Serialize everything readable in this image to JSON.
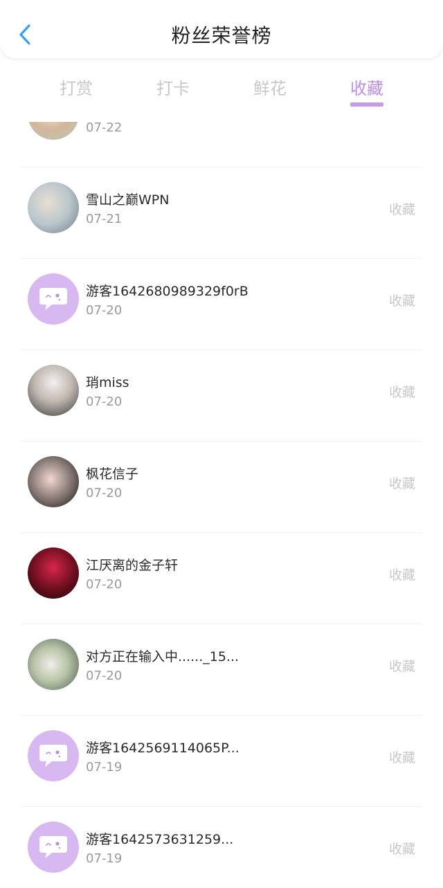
{
  "header": {
    "title": "粉丝荣誉榜",
    "back_icon": "chevron-left-icon",
    "accent_color": "#3a9ff0"
  },
  "tabs": [
    {
      "label": "打赏",
      "active": false
    },
    {
      "label": "打卡",
      "active": false
    },
    {
      "label": "鲜花",
      "active": false
    },
    {
      "label": "收藏",
      "active": true
    }
  ],
  "theme": {
    "active_tab_color": "#bd8ee8",
    "inactive_tab_color": "#c8c8c8"
  },
  "list": {
    "partial_top": {
      "date": "07-22"
    },
    "items": [
      {
        "name": "雪山之巅WPN",
        "date": "07-21",
        "action": "收藏",
        "avatar": "photo"
      },
      {
        "name": "游客1642680989329f0rB",
        "date": "07-20",
        "action": "收藏",
        "avatar": "default-chat-icon"
      },
      {
        "name": "琑miss",
        "date": "07-20",
        "action": "收藏",
        "avatar": "photo"
      },
      {
        "name": "枫花信子",
        "date": "07-20",
        "action": "收藏",
        "avatar": "photo"
      },
      {
        "name": "江厌离的金子轩",
        "date": "07-20",
        "action": "收藏",
        "avatar": "photo"
      },
      {
        "name": "对方正在输入中......_15...",
        "date": "07-20",
        "action": "收藏",
        "avatar": "photo"
      },
      {
        "name": "游客1642569114065P...",
        "date": "07-19",
        "action": "收藏",
        "avatar": "default-chat-icon"
      },
      {
        "name": "游客1642573631259...",
        "date": "07-19",
        "action": "收藏",
        "avatar": "default-chat-icon"
      }
    ]
  }
}
